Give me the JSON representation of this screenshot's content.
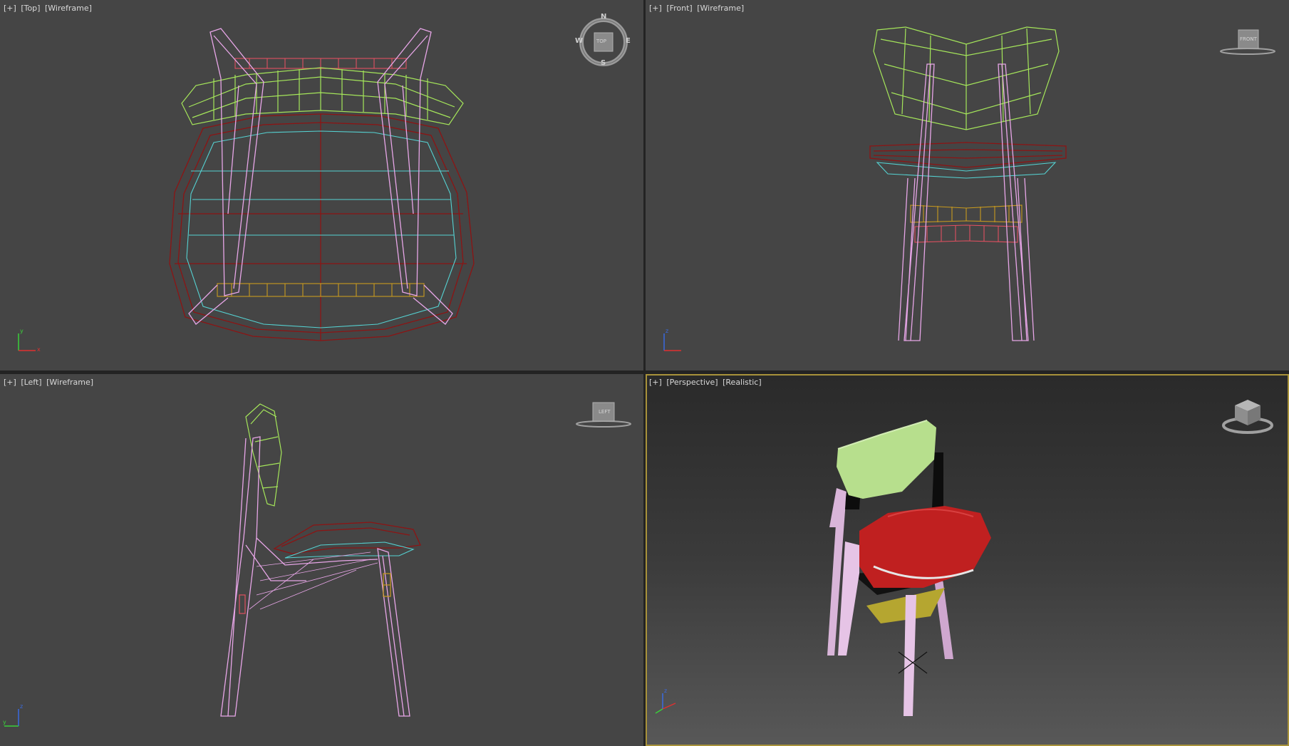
{
  "viewports": {
    "top": {
      "menu": "[+]",
      "view": "[Top]",
      "shading": "[Wireframe]"
    },
    "front": {
      "menu": "[+]",
      "view": "[Front]",
      "shading": "[Wireframe]"
    },
    "left": {
      "menu": "[+]",
      "view": "[Left]",
      "shading": "[Wireframe]"
    },
    "perspective": {
      "menu": "[+]",
      "view": "[Perspective]",
      "shading": "[Realistic]"
    }
  },
  "viewcube": {
    "top_label": "TOP",
    "front_label": "FRONT",
    "left_label": "LEFT",
    "compass": {
      "n": "N",
      "s": "S",
      "e": "E",
      "w": "W"
    }
  },
  "axes": {
    "x": "x",
    "y": "y",
    "z": "z"
  },
  "colors": {
    "backrest": "#a5e65a",
    "seat_top": "#8c1414",
    "seat_bottom": "#55d2d2",
    "legs": "#e8a6e8",
    "stretcher": "#c89a1e",
    "stretcher_red": "#e05060",
    "active_border": "#a8923a"
  }
}
